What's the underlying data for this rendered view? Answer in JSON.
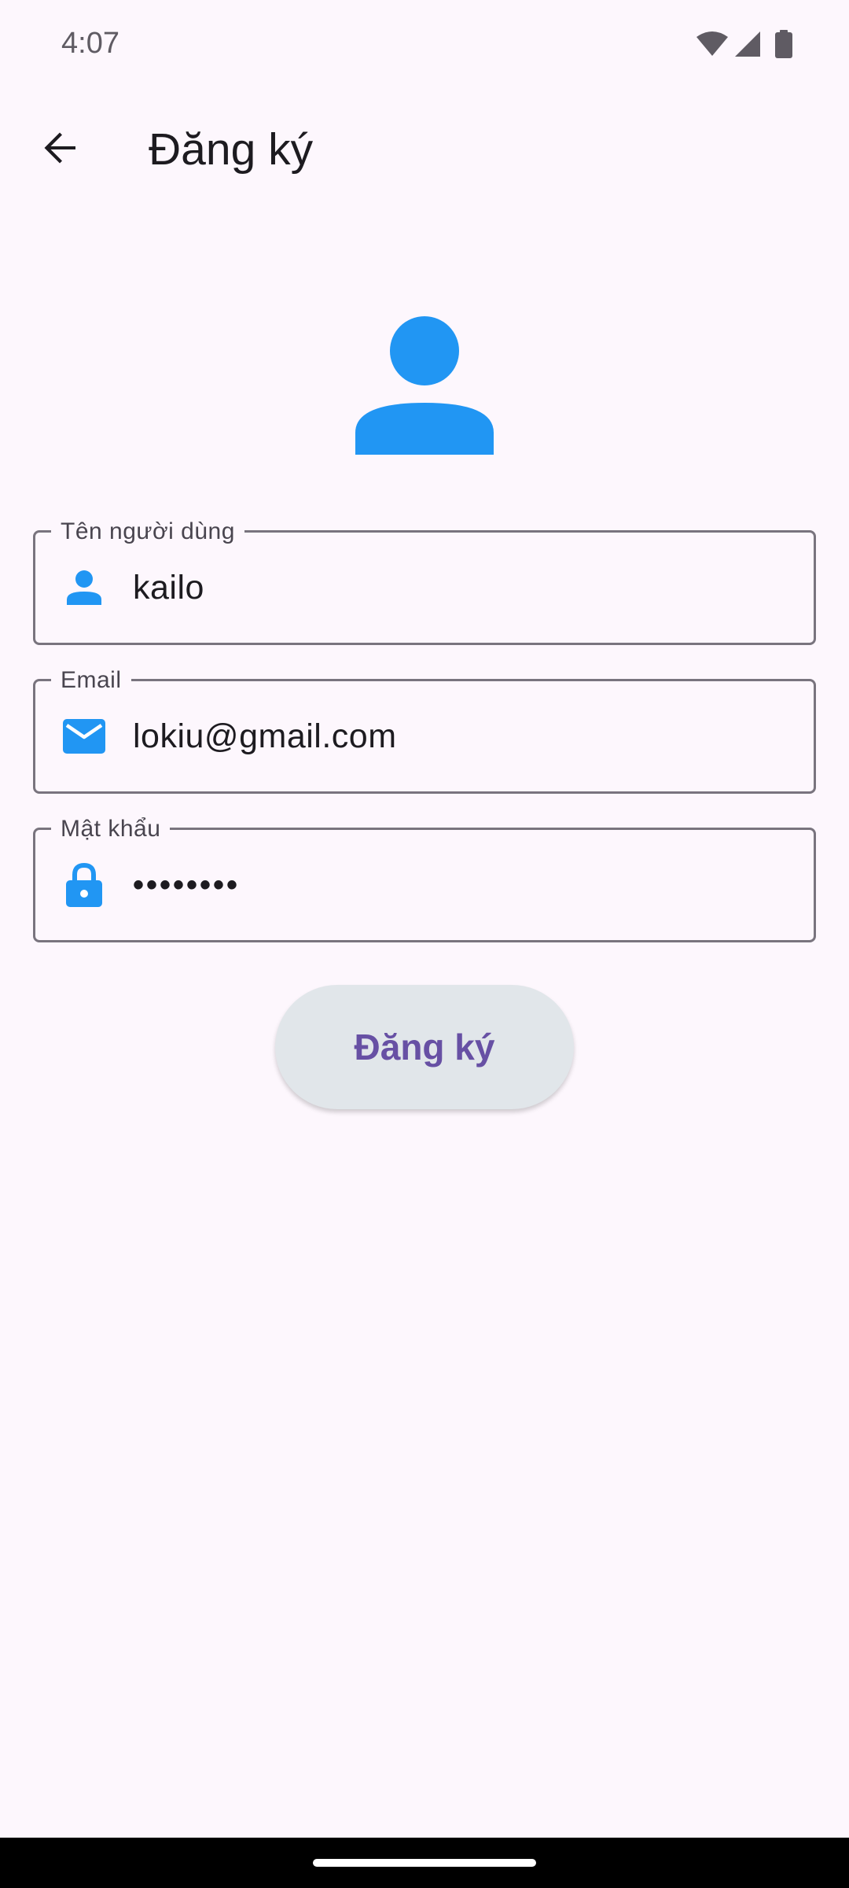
{
  "status_bar": {
    "time": "4:07",
    "icons": [
      "wifi-icon",
      "cellular-signal-icon",
      "battery-icon"
    ]
  },
  "app_bar": {
    "back_icon": "arrow-back-icon",
    "title": "Đăng ký"
  },
  "avatar": {
    "icon": "person-icon",
    "color": "#2196F3"
  },
  "form": {
    "username": {
      "label": "Tên người dùng",
      "value": "kailo",
      "icon": "person-icon"
    },
    "email": {
      "label": "Email",
      "value": "lokiu@gmail.com",
      "icon": "mail-icon"
    },
    "password": {
      "label": "Mật khẩu",
      "value": "••••••••",
      "icon": "lock-icon"
    }
  },
  "register_button": {
    "label": "Đăng ký"
  },
  "colors": {
    "background": "#FDF7FD",
    "accent_icon": "#2196F3",
    "button_text": "#6750A4",
    "button_bg": "#E1E6EA",
    "outline": "#79747E"
  }
}
